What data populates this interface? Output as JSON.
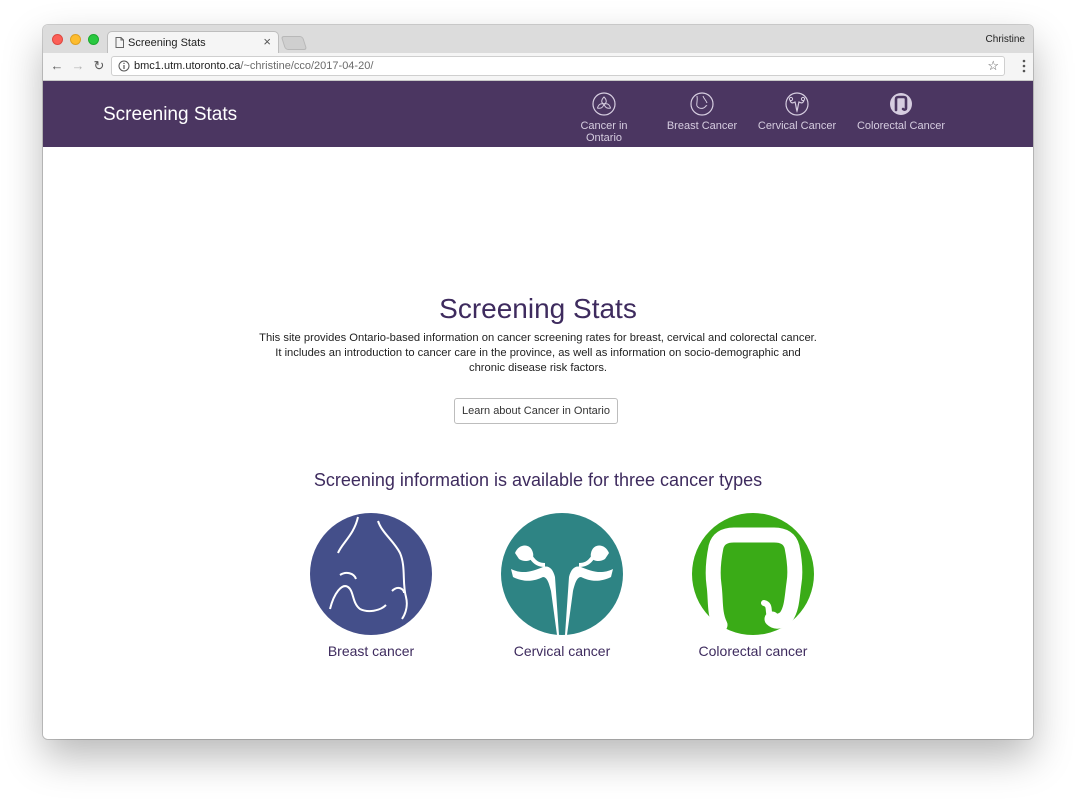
{
  "browser": {
    "tab_title": "Screening Stats",
    "tab_close": "×",
    "profile": "Christine",
    "url_host": "bmc1.utm.utoronto.ca",
    "url_path": "/~christine/cco/2017-04-20/",
    "back": "←",
    "forward": "→",
    "reload": "↻",
    "star": "☆"
  },
  "header": {
    "brand": "Screening Stats",
    "nav": [
      {
        "label": "Cancer in Ontario",
        "icon": "ontario-trillium-icon"
      },
      {
        "label": "Breast Cancer",
        "icon": "breast-icon"
      },
      {
        "label": "Cervical Cancer",
        "icon": "uterus-icon"
      },
      {
        "label": "Colorectal Cancer",
        "icon": "colon-icon"
      }
    ]
  },
  "hero": {
    "title": "Screening Stats",
    "text": "This site provides Ontario-based information on cancer screening rates for breast, cervical and colorectal cancer. It includes an introduction to cancer care in the province, as well as information on socio-demographic and chronic disease risk factors.",
    "button": "Learn about Cancer in Ontario"
  },
  "types": {
    "heading": "Screening information is available for three cancer types",
    "items": [
      {
        "label": "Breast cancer",
        "color": "#444f8a",
        "icon": "breast-icon"
      },
      {
        "label": "Cervical cancer",
        "color": "#2e8484",
        "icon": "uterus-icon"
      },
      {
        "label": "Colorectal cancer",
        "color": "#3aab17",
        "icon": "colon-icon"
      }
    ]
  }
}
